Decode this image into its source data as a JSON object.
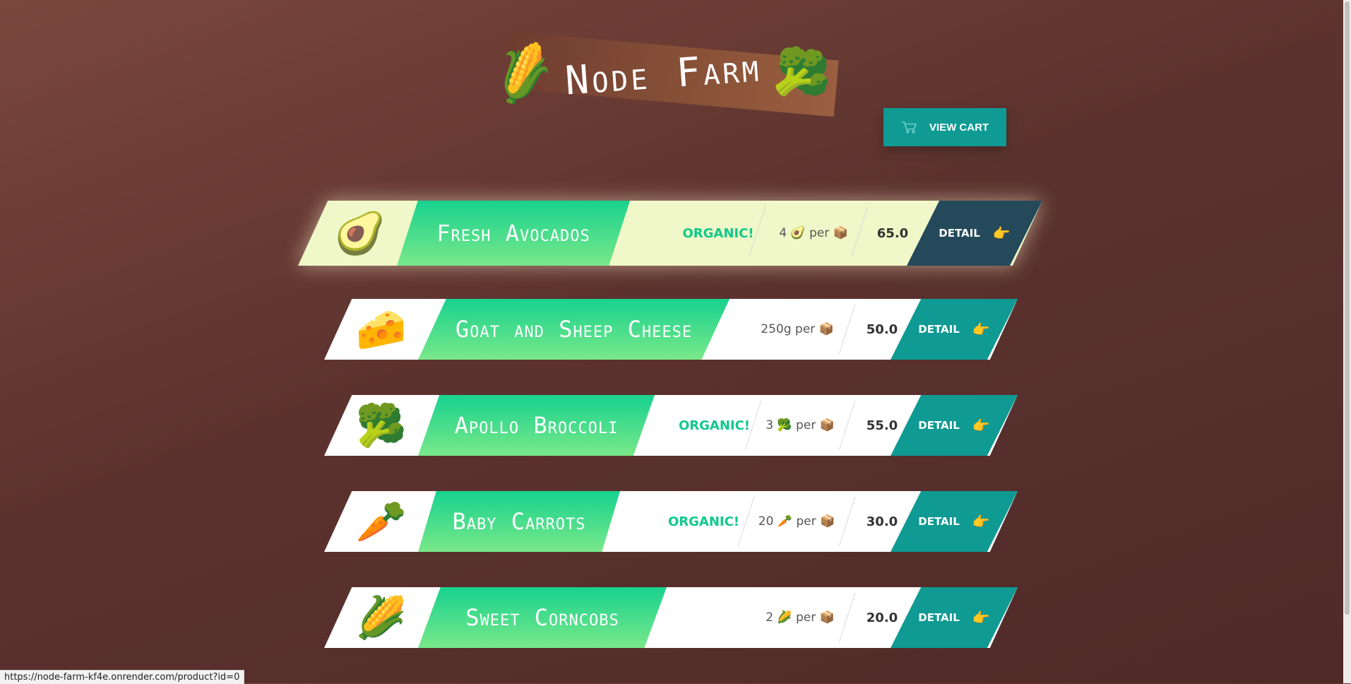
{
  "header": {
    "title": "Node Farm",
    "left_emoji": "🌽",
    "right_emoji": "🥦",
    "cart_button": "VIEW CART",
    "cart_icon": "cart-icon"
  },
  "products": [
    {
      "emoji": "🥑",
      "name": "Fresh Avocados",
      "organic": "ORGANIC!",
      "quantity": "4 🥑 per 📦",
      "price": "65.0",
      "detail": "DETAIL",
      "pointer": "👉"
    },
    {
      "emoji": "🧀",
      "name": "Goat and Sheep Cheese",
      "organic": "",
      "quantity": "250g per 📦",
      "price": "50.0",
      "detail": "DETAIL",
      "pointer": "👉"
    },
    {
      "emoji": "🥦",
      "name": "Apollo Broccoli",
      "organic": "ORGANIC!",
      "quantity": "3 🥦 per 📦",
      "price": "55.0",
      "detail": "DETAIL",
      "pointer": "👉"
    },
    {
      "emoji": "🥕",
      "name": "Baby Carrots",
      "organic": "ORGANIC!",
      "quantity": "20 🥕 per 📦",
      "price": "30.0",
      "detail": "DETAIL",
      "pointer": "👉"
    },
    {
      "emoji": "🌽",
      "name": "Sweet Corncobs",
      "organic": "",
      "quantity": "2 🌽 per 📦",
      "price": "20.0",
      "detail": "DETAIL",
      "pointer": "👉"
    }
  ],
  "status_bar": {
    "url": "https://node-farm-kf4e.onrender.com/product?id=0"
  },
  "colors": {
    "accent_teal": "#0f9a93",
    "organic_green": "#10c98b",
    "featured_detail": "#24495a"
  }
}
